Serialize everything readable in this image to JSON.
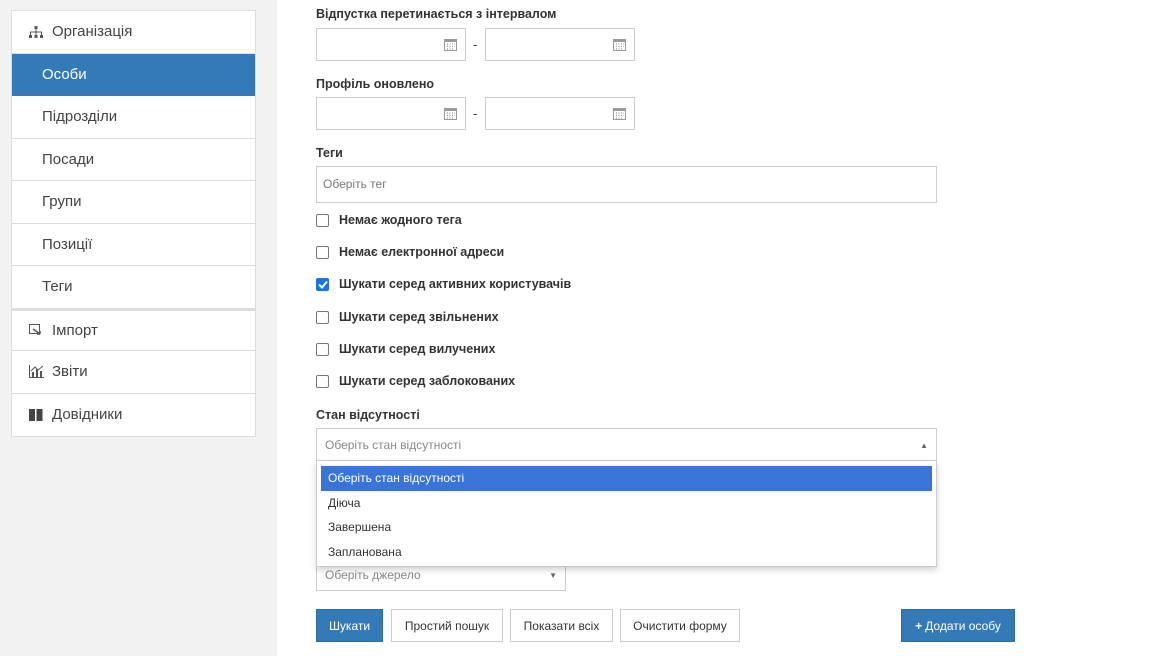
{
  "sidebar": {
    "items": [
      {
        "label": "Організація",
        "icon": "sitemap-icon"
      },
      {
        "label": "Особи"
      },
      {
        "label": "Підрозділи"
      },
      {
        "label": "Посади"
      },
      {
        "label": "Групи"
      },
      {
        "label": "Позиції"
      },
      {
        "label": "Теги"
      },
      {
        "label": "Імпорт",
        "icon": "import-icon"
      },
      {
        "label": "Звіти",
        "icon": "chart-icon"
      },
      {
        "label": "Довідники",
        "icon": "book-icon"
      }
    ]
  },
  "form": {
    "vacation_label": "Відпустка перетинається з інтервалом",
    "profile_label": "Профіль оновлено",
    "dash": "-",
    "tags_label": "Теги",
    "tags_placeholder": "Оберіть тег",
    "checks": [
      {
        "label": "Немає жодного тега",
        "checked": false
      },
      {
        "label": "Немає електронної адреси",
        "checked": false
      },
      {
        "label": "Шукати серед активних користувачів",
        "checked": true
      },
      {
        "label": "Шукати серед звільнених",
        "checked": false
      },
      {
        "label": "Шукати серед вилучених",
        "checked": false
      },
      {
        "label": "Шукати серед заблокованих",
        "checked": false
      }
    ],
    "absence_label": "Стан відсутності",
    "absence_placeholder": "Оберіть стан відсутності",
    "absence_options": [
      "Оберіть стан відсутності",
      "Діюча",
      "Завершена",
      "Запланована"
    ],
    "source_placeholder": "Оберіть джерело"
  },
  "buttons": {
    "search": "Шукати",
    "simple_search": "Простий пошук",
    "show_all": "Показати всіх",
    "clear_form": "Очистити форму",
    "add_person": "Додати особу"
  },
  "colors": {
    "accent": "#337ab7",
    "dropdown_selected": "#3875d7"
  }
}
